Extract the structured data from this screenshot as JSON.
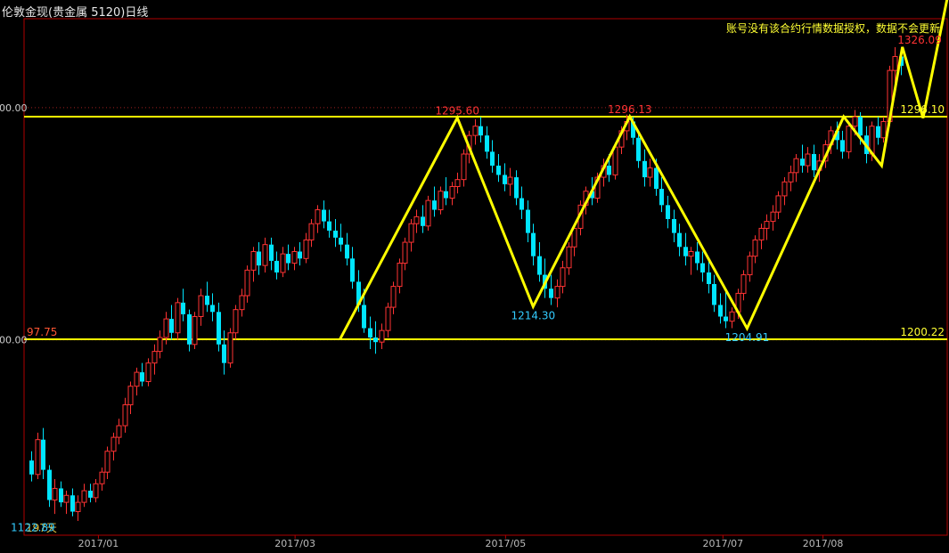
{
  "header": {
    "title": "伦敦金现(贵金属 5120)日线",
    "notice": "账号没有该合约行情数据授权，数据不会更新"
  },
  "footer": {
    "days_label": "197天"
  },
  "colors": {
    "background": "#000000",
    "up_candle": "#ff3333",
    "down_candle": "#00e5ff",
    "pattern": "#ffff00",
    "frame": "#b00000",
    "high_label": "#ff3333",
    "low_label": "#33ccff",
    "level_label": "#ffff33"
  },
  "chart_data": {
    "type": "candlestick",
    "y_axis_labels": [
      {
        "value": 1300,
        "text": "00.00"
      },
      {
        "value": 1200,
        "text": "00.00"
      }
    ],
    "x_labels": [
      {
        "date": "2017-01-03",
        "text": "2017/01"
      },
      {
        "date": "2017-03-01",
        "text": "2017/03"
      },
      {
        "date": "2017-05-01",
        "text": "2017/05"
      },
      {
        "date": "2017-07-03",
        "text": "2017/07"
      },
      {
        "date": "2017-08-01",
        "text": "2017/08"
      }
    ],
    "horizontal_lines": [
      {
        "value": 1296.1,
        "label": "1296.10"
      },
      {
        "value": 1200.22,
        "label": "1200.22"
      }
    ],
    "left_level_label": {
      "value": 1200.22,
      "text": "97.75"
    },
    "annotations": [
      {
        "value": 1122.89,
        "text": "1122.89",
        "kind": "low",
        "date": "2016-12-15"
      },
      {
        "value": 1295.6,
        "text": "1295.60",
        "kind": "high",
        "date": "2017-04-17"
      },
      {
        "value": 1214.3,
        "text": "1214.30",
        "kind": "low",
        "date": "2017-05-09"
      },
      {
        "value": 1296.13,
        "text": "1296.13",
        "kind": "high",
        "date": "2017-06-06"
      },
      {
        "value": 1204.91,
        "text": "1204.91",
        "kind": "low",
        "date": "2017-07-10"
      },
      {
        "value": 1326.09,
        "text": "1326.09",
        "kind": "high",
        "date": "2017-08-29"
      }
    ],
    "pattern_path": [
      {
        "date": "2017-03-14",
        "value": 1200.2
      },
      {
        "date": "2017-04-17",
        "value": 1295.6
      },
      {
        "date": "2017-05-09",
        "value": 1214.3
      },
      {
        "date": "2017-06-06",
        "value": 1296.1
      },
      {
        "date": "2017-07-10",
        "value": 1204.9
      },
      {
        "date": "2017-08-07",
        "value": 1296.1
      },
      {
        "date": "2017-08-18",
        "value": 1275.0
      },
      {
        "date": "2017-08-24",
        "value": 1326.1
      },
      {
        "date": "2017-08-30",
        "value": 1295.5
      },
      {
        "date": "2017-09-06",
        "value": 1347.0
      }
    ],
    "candles": [
      {
        "o": 1148,
        "h": 1152,
        "l": 1139,
        "c": 1142
      },
      {
        "o": 1142,
        "h": 1160,
        "l": 1140,
        "c": 1157
      },
      {
        "o": 1157,
        "h": 1162,
        "l": 1140,
        "c": 1144
      },
      {
        "o": 1144,
        "h": 1146,
        "l": 1128,
        "c": 1131
      },
      {
        "o": 1131,
        "h": 1140,
        "l": 1125,
        "c": 1136
      },
      {
        "o": 1136,
        "h": 1139,
        "l": 1128,
        "c": 1130
      },
      {
        "o": 1130,
        "h": 1135,
        "l": 1125,
        "c": 1133
      },
      {
        "o": 1133,
        "h": 1136,
        "l": 1124,
        "c": 1126
      },
      {
        "o": 1126,
        "h": 1133,
        "l": 1122,
        "c": 1130
      },
      {
        "o": 1130,
        "h": 1138,
        "l": 1128,
        "c": 1135
      },
      {
        "o": 1135,
        "h": 1138,
        "l": 1130,
        "c": 1132
      },
      {
        "o": 1132,
        "h": 1140,
        "l": 1130,
        "c": 1138
      },
      {
        "o": 1138,
        "h": 1145,
        "l": 1135,
        "c": 1143
      },
      {
        "o": 1143,
        "h": 1154,
        "l": 1140,
        "c": 1152
      },
      {
        "o": 1152,
        "h": 1160,
        "l": 1148,
        "c": 1158
      },
      {
        "o": 1158,
        "h": 1166,
        "l": 1155,
        "c": 1163
      },
      {
        "o": 1163,
        "h": 1175,
        "l": 1160,
        "c": 1172
      },
      {
        "o": 1172,
        "h": 1182,
        "l": 1168,
        "c": 1180
      },
      {
        "o": 1180,
        "h": 1188,
        "l": 1176,
        "c": 1186
      },
      {
        "o": 1186,
        "h": 1190,
        "l": 1180,
        "c": 1182
      },
      {
        "o": 1182,
        "h": 1192,
        "l": 1180,
        "c": 1190
      },
      {
        "o": 1190,
        "h": 1198,
        "l": 1185,
        "c": 1195
      },
      {
        "o": 1195,
        "h": 1204,
        "l": 1192,
        "c": 1201
      },
      {
        "o": 1201,
        "h": 1212,
        "l": 1198,
        "c": 1209
      },
      {
        "o": 1209,
        "h": 1215,
        "l": 1200,
        "c": 1203
      },
      {
        "o": 1203,
        "h": 1218,
        "l": 1200,
        "c": 1216
      },
      {
        "o": 1216,
        "h": 1222,
        "l": 1208,
        "c": 1211
      },
      {
        "o": 1211,
        "h": 1213,
        "l": 1195,
        "c": 1198
      },
      {
        "o": 1198,
        "h": 1212,
        "l": 1196,
        "c": 1210
      },
      {
        "o": 1210,
        "h": 1222,
        "l": 1206,
        "c": 1219
      },
      {
        "o": 1219,
        "h": 1225,
        "l": 1212,
        "c": 1215
      },
      {
        "o": 1215,
        "h": 1220,
        "l": 1208,
        "c": 1212
      },
      {
        "o": 1212,
        "h": 1216,
        "l": 1195,
        "c": 1198
      },
      {
        "o": 1198,
        "h": 1204,
        "l": 1185,
        "c": 1190
      },
      {
        "o": 1190,
        "h": 1205,
        "l": 1188,
        "c": 1203
      },
      {
        "o": 1203,
        "h": 1215,
        "l": 1200,
        "c": 1213
      },
      {
        "o": 1213,
        "h": 1222,
        "l": 1210,
        "c": 1219
      },
      {
        "o": 1219,
        "h": 1232,
        "l": 1216,
        "c": 1230
      },
      {
        "o": 1230,
        "h": 1240,
        "l": 1225,
        "c": 1238
      },
      {
        "o": 1238,
        "h": 1242,
        "l": 1228,
        "c": 1232
      },
      {
        "o": 1232,
        "h": 1244,
        "l": 1229,
        "c": 1241
      },
      {
        "o": 1241,
        "h": 1244,
        "l": 1230,
        "c": 1234
      },
      {
        "o": 1234,
        "h": 1238,
        "l": 1226,
        "c": 1229
      },
      {
        "o": 1229,
        "h": 1240,
        "l": 1227,
        "c": 1237
      },
      {
        "o": 1237,
        "h": 1241,
        "l": 1230,
        "c": 1233
      },
      {
        "o": 1233,
        "h": 1240,
        "l": 1230,
        "c": 1238
      },
      {
        "o": 1238,
        "h": 1242,
        "l": 1232,
        "c": 1235
      },
      {
        "o": 1235,
        "h": 1246,
        "l": 1233,
        "c": 1243
      },
      {
        "o": 1243,
        "h": 1252,
        "l": 1240,
        "c": 1250
      },
      {
        "o": 1250,
        "h": 1258,
        "l": 1246,
        "c": 1256
      },
      {
        "o": 1256,
        "h": 1260,
        "l": 1248,
        "c": 1251
      },
      {
        "o": 1251,
        "h": 1256,
        "l": 1244,
        "c": 1247
      },
      {
        "o": 1247,
        "h": 1252,
        "l": 1240,
        "c": 1244
      },
      {
        "o": 1244,
        "h": 1250,
        "l": 1238,
        "c": 1241
      },
      {
        "o": 1241,
        "h": 1246,
        "l": 1232,
        "c": 1235
      },
      {
        "o": 1235,
        "h": 1240,
        "l": 1222,
        "c": 1225
      },
      {
        "o": 1225,
        "h": 1230,
        "l": 1212,
        "c": 1215
      },
      {
        "o": 1215,
        "h": 1222,
        "l": 1203,
        "c": 1205
      },
      {
        "o": 1205,
        "h": 1210,
        "l": 1196,
        "c": 1201
      },
      {
        "o": 1201,
        "h": 1208,
        "l": 1194,
        "c": 1199
      },
      {
        "o": 1199,
        "h": 1207,
        "l": 1196,
        "c": 1204
      },
      {
        "o": 1204,
        "h": 1216,
        "l": 1201,
        "c": 1214
      },
      {
        "o": 1214,
        "h": 1225,
        "l": 1211,
        "c": 1223
      },
      {
        "o": 1223,
        "h": 1235,
        "l": 1220,
        "c": 1233
      },
      {
        "o": 1233,
        "h": 1244,
        "l": 1230,
        "c": 1242
      },
      {
        "o": 1242,
        "h": 1252,
        "l": 1238,
        "c": 1250
      },
      {
        "o": 1250,
        "h": 1256,
        "l": 1246,
        "c": 1253
      },
      {
        "o": 1253,
        "h": 1258,
        "l": 1246,
        "c": 1249
      },
      {
        "o": 1249,
        "h": 1262,
        "l": 1247,
        "c": 1260
      },
      {
        "o": 1260,
        "h": 1266,
        "l": 1253,
        "c": 1256
      },
      {
        "o": 1256,
        "h": 1266,
        "l": 1254,
        "c": 1264
      },
      {
        "o": 1264,
        "h": 1270,
        "l": 1258,
        "c": 1261
      },
      {
        "o": 1261,
        "h": 1268,
        "l": 1258,
        "c": 1266
      },
      {
        "o": 1266,
        "h": 1272,
        "l": 1263,
        "c": 1269
      },
      {
        "o": 1269,
        "h": 1282,
        "l": 1266,
        "c": 1280
      },
      {
        "o": 1280,
        "h": 1290,
        "l": 1276,
        "c": 1288
      },
      {
        "o": 1288,
        "h": 1295,
        "l": 1284,
        "c": 1292
      },
      {
        "o": 1292,
        "h": 1296,
        "l": 1285,
        "c": 1288
      },
      {
        "o": 1288,
        "h": 1292,
        "l": 1278,
        "c": 1281
      },
      {
        "o": 1281,
        "h": 1286,
        "l": 1272,
        "c": 1275
      },
      {
        "o": 1275,
        "h": 1280,
        "l": 1268,
        "c": 1271
      },
      {
        "o": 1271,
        "h": 1276,
        "l": 1264,
        "c": 1267
      },
      {
        "o": 1267,
        "h": 1274,
        "l": 1262,
        "c": 1270
      },
      {
        "o": 1270,
        "h": 1273,
        "l": 1258,
        "c": 1261
      },
      {
        "o": 1261,
        "h": 1266,
        "l": 1252,
        "c": 1256
      },
      {
        "o": 1256,
        "h": 1260,
        "l": 1242,
        "c": 1246
      },
      {
        "o": 1246,
        "h": 1250,
        "l": 1232,
        "c": 1236
      },
      {
        "o": 1236,
        "h": 1242,
        "l": 1225,
        "c": 1228
      },
      {
        "o": 1228,
        "h": 1235,
        "l": 1218,
        "c": 1222
      },
      {
        "o": 1222,
        "h": 1228,
        "l": 1215,
        "c": 1218
      },
      {
        "o": 1218,
        "h": 1226,
        "l": 1214,
        "c": 1223
      },
      {
        "o": 1223,
        "h": 1234,
        "l": 1220,
        "c": 1231
      },
      {
        "o": 1231,
        "h": 1242,
        "l": 1228,
        "c": 1240
      },
      {
        "o": 1240,
        "h": 1250,
        "l": 1236,
        "c": 1248
      },
      {
        "o": 1248,
        "h": 1260,
        "l": 1245,
        "c": 1258
      },
      {
        "o": 1258,
        "h": 1266,
        "l": 1254,
        "c": 1264
      },
      {
        "o": 1264,
        "h": 1270,
        "l": 1258,
        "c": 1261
      },
      {
        "o": 1261,
        "h": 1272,
        "l": 1259,
        "c": 1270
      },
      {
        "o": 1270,
        "h": 1278,
        "l": 1266,
        "c": 1275
      },
      {
        "o": 1275,
        "h": 1280,
        "l": 1268,
        "c": 1271
      },
      {
        "o": 1271,
        "h": 1285,
        "l": 1269,
        "c": 1283
      },
      {
        "o": 1283,
        "h": 1292,
        "l": 1280,
        "c": 1290
      },
      {
        "o": 1290,
        "h": 1297,
        "l": 1286,
        "c": 1294
      },
      {
        "o": 1294,
        "h": 1296,
        "l": 1284,
        "c": 1287
      },
      {
        "o": 1287,
        "h": 1290,
        "l": 1274,
        "c": 1277
      },
      {
        "o": 1277,
        "h": 1282,
        "l": 1266,
        "c": 1270
      },
      {
        "o": 1270,
        "h": 1278,
        "l": 1266,
        "c": 1274
      },
      {
        "o": 1274,
        "h": 1278,
        "l": 1262,
        "c": 1265
      },
      {
        "o": 1265,
        "h": 1270,
        "l": 1255,
        "c": 1258
      },
      {
        "o": 1258,
        "h": 1262,
        "l": 1248,
        "c": 1252
      },
      {
        "o": 1252,
        "h": 1256,
        "l": 1242,
        "c": 1246
      },
      {
        "o": 1246,
        "h": 1250,
        "l": 1236,
        "c": 1240
      },
      {
        "o": 1240,
        "h": 1246,
        "l": 1232,
        "c": 1236
      },
      {
        "o": 1236,
        "h": 1240,
        "l": 1228,
        "c": 1238
      },
      {
        "o": 1238,
        "h": 1242,
        "l": 1230,
        "c": 1233
      },
      {
        "o": 1233,
        "h": 1238,
        "l": 1225,
        "c": 1229
      },
      {
        "o": 1229,
        "h": 1234,
        "l": 1220,
        "c": 1224
      },
      {
        "o": 1224,
        "h": 1228,
        "l": 1212,
        "c": 1215
      },
      {
        "o": 1215,
        "h": 1220,
        "l": 1207,
        "c": 1210
      },
      {
        "o": 1210,
        "h": 1222,
        "l": 1205,
        "c": 1208
      },
      {
        "o": 1208,
        "h": 1214,
        "l": 1205,
        "c": 1212
      },
      {
        "o": 1212,
        "h": 1222,
        "l": 1209,
        "c": 1220
      },
      {
        "o": 1220,
        "h": 1230,
        "l": 1217,
        "c": 1228
      },
      {
        "o": 1228,
        "h": 1238,
        "l": 1225,
        "c": 1236
      },
      {
        "o": 1236,
        "h": 1245,
        "l": 1233,
        "c": 1243
      },
      {
        "o": 1243,
        "h": 1250,
        "l": 1239,
        "c": 1248
      },
      {
        "o": 1248,
        "h": 1254,
        "l": 1243,
        "c": 1251
      },
      {
        "o": 1251,
        "h": 1258,
        "l": 1247,
        "c": 1255
      },
      {
        "o": 1255,
        "h": 1264,
        "l": 1252,
        "c": 1262
      },
      {
        "o": 1262,
        "h": 1270,
        "l": 1258,
        "c": 1268
      },
      {
        "o": 1268,
        "h": 1275,
        "l": 1264,
        "c": 1272
      },
      {
        "o": 1272,
        "h": 1280,
        "l": 1268,
        "c": 1278
      },
      {
        "o": 1278,
        "h": 1284,
        "l": 1272,
        "c": 1275
      },
      {
        "o": 1275,
        "h": 1283,
        "l": 1272,
        "c": 1280
      },
      {
        "o": 1280,
        "h": 1284,
        "l": 1270,
        "c": 1273
      },
      {
        "o": 1273,
        "h": 1280,
        "l": 1268,
        "c": 1277
      },
      {
        "o": 1277,
        "h": 1286,
        "l": 1274,
        "c": 1284
      },
      {
        "o": 1284,
        "h": 1292,
        "l": 1280,
        "c": 1290
      },
      {
        "o": 1290,
        "h": 1294,
        "l": 1282,
        "c": 1286
      },
      {
        "o": 1286,
        "h": 1290,
        "l": 1278,
        "c": 1281
      },
      {
        "o": 1281,
        "h": 1294,
        "l": 1278,
        "c": 1292
      },
      {
        "o": 1292,
        "h": 1299,
        "l": 1288,
        "c": 1296
      },
      {
        "o": 1296,
        "h": 1298,
        "l": 1284,
        "c": 1288
      },
      {
        "o": 1288,
        "h": 1292,
        "l": 1276,
        "c": 1280
      },
      {
        "o": 1280,
        "h": 1294,
        "l": 1277,
        "c": 1292
      },
      {
        "o": 1292,
        "h": 1296,
        "l": 1284,
        "c": 1287
      },
      {
        "o": 1287,
        "h": 1296,
        "l": 1285,
        "c": 1294
      },
      {
        "o": 1294,
        "h": 1318,
        "l": 1292,
        "c": 1316
      },
      {
        "o": 1316,
        "h": 1326,
        "l": 1310,
        "c": 1322
      },
      {
        "o": 1322,
        "h": 1326,
        "l": 1314,
        "c": 1318
      }
    ]
  }
}
